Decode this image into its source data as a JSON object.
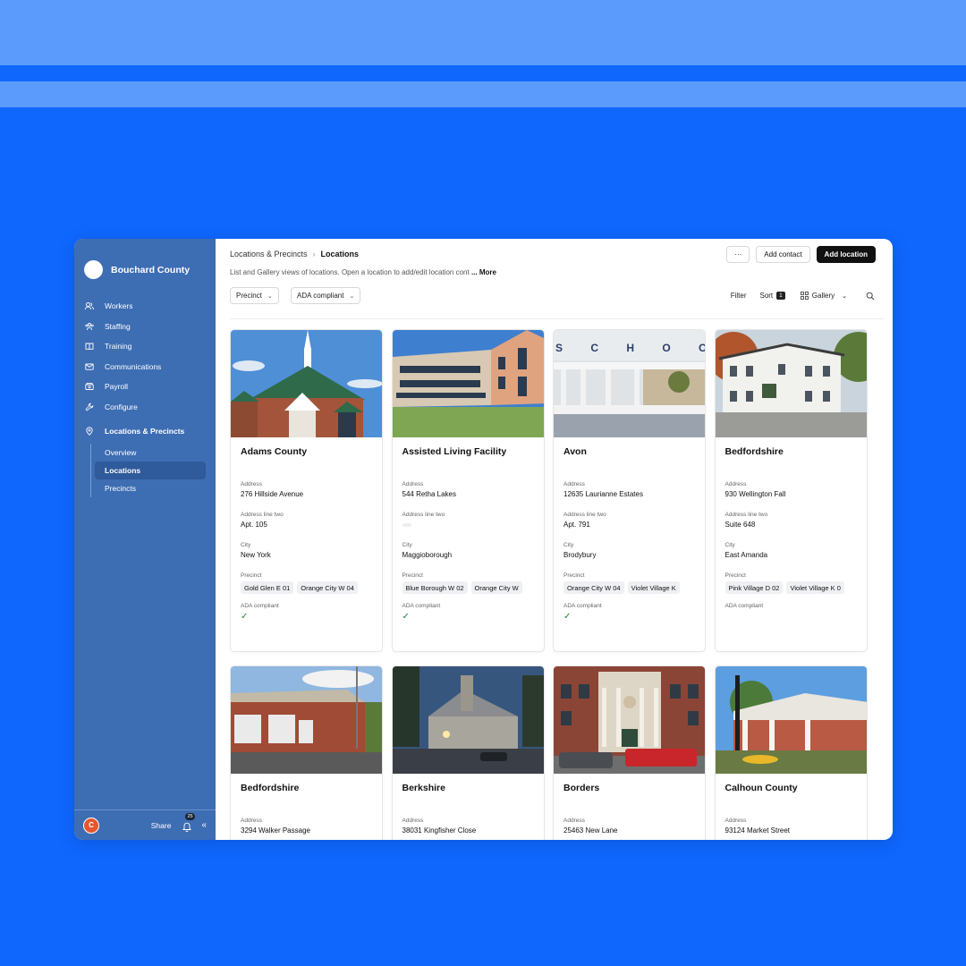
{
  "org": {
    "name": "Bouchard County"
  },
  "sidebar": {
    "items": [
      {
        "label": "Workers",
        "icon": "users-icon"
      },
      {
        "label": "Staffing",
        "icon": "team-icon"
      },
      {
        "label": "Training",
        "icon": "book-icon"
      },
      {
        "label": "Communications",
        "icon": "mail-icon"
      },
      {
        "label": "Payroll",
        "icon": "money-icon"
      },
      {
        "label": "Configure",
        "icon": "wrench-icon"
      }
    ],
    "group": {
      "label": "Locations & Precincts",
      "icon": "map-pin-icon"
    },
    "sub_items": [
      "Overview",
      "Locations",
      "Precincts"
    ],
    "active_sub": "Locations",
    "footer": {
      "avatar": "C",
      "share": "Share",
      "notifications": "25"
    }
  },
  "header": {
    "breadcrumb_parent": "Locations & Precincts",
    "breadcrumb_current": "Locations",
    "description": "List and Gallery views of locations. Open a location to add/edit location cont",
    "more": "... More",
    "more_button": "···",
    "add_contact": "Add contact",
    "add_location": "Add location"
  },
  "toolbar": {
    "filter_precinct": "Precinct",
    "filter_ada": "ADA compliant",
    "filter": "Filter",
    "sort": "Sort",
    "sort_count": "1",
    "view": "Gallery"
  },
  "field_labels": {
    "address": "Address",
    "address2": "Address line two",
    "city": "City",
    "precinct": "Precinct",
    "ada": "ADA compliant"
  },
  "cards": [
    {
      "name": "Adams County",
      "address": "276 Hillside Avenue",
      "address2": "Apt. 105",
      "city": "New York",
      "precincts": [
        "Gold Glen E 01",
        "Orange City W 04"
      ],
      "ada": true
    },
    {
      "name": "Assisted Living Facility",
      "address": "544 Retha Lakes",
      "address2": "",
      "city": "Maggioborough",
      "precincts": [
        "Blue Borough W 02",
        "Orange City W"
      ],
      "ada": true
    },
    {
      "name": "Avon",
      "address": "12635 Laurianne Estates",
      "address2": "Apt. 791",
      "city": "Brodybury",
      "precincts": [
        "Orange City W 04",
        "Violet Village K"
      ],
      "ada": true
    },
    {
      "name": "Bedfordshire",
      "address": "930 Wellington Fall",
      "address2": "Suite 648",
      "city": "East Amanda",
      "precincts": [
        "Pink Village D 02",
        "Violet Village K 0"
      ],
      "ada": false
    },
    {
      "name": "Bedfordshire",
      "address": "3294 Walker Passage"
    },
    {
      "name": "Berkshire",
      "address": "38031 Kingfisher Close"
    },
    {
      "name": "Borders",
      "address": "25463 New Lane"
    },
    {
      "name": "Calhoun County",
      "address": "93124 Market Street"
    }
  ],
  "photo_text": "S C H O O L"
}
